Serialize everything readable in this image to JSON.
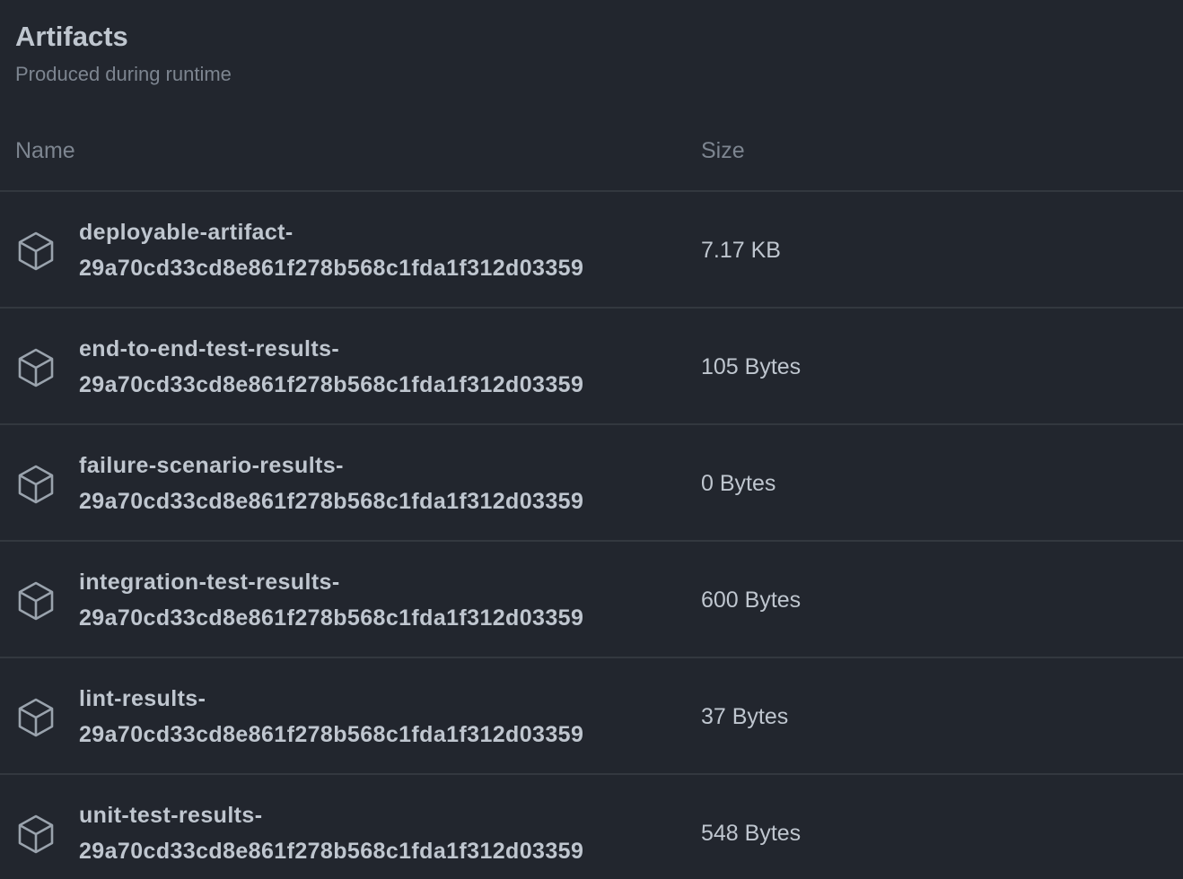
{
  "header": {
    "title": "Artifacts",
    "subtitle": "Produced during runtime"
  },
  "table": {
    "columns": {
      "name": "Name",
      "size": "Size"
    },
    "rows": [
      {
        "name_line1": "deployable-artifact-",
        "name_line2": "29a70cd33cd8e861f278b568c1fda1f312d03359",
        "size": "7.17 KB",
        "icon": "package-icon"
      },
      {
        "name_line1": "end-to-end-test-results-",
        "name_line2": "29a70cd33cd8e861f278b568c1fda1f312d03359",
        "size": "105 Bytes",
        "icon": "package-icon"
      },
      {
        "name_line1": "failure-scenario-results-",
        "name_line2": "29a70cd33cd8e861f278b568c1fda1f312d03359",
        "size": "0 Bytes",
        "icon": "package-icon"
      },
      {
        "name_line1": "integration-test-results-",
        "name_line2": "29a70cd33cd8e861f278b568c1fda1f312d03359",
        "size": "600 Bytes",
        "icon": "package-icon"
      },
      {
        "name_line1": "lint-results-",
        "name_line2": "29a70cd33cd8e861f278b568c1fda1f312d03359",
        "size": "37 Bytes",
        "icon": "package-icon"
      },
      {
        "name_line1": "unit-test-results-",
        "name_line2": "29a70cd33cd8e861f278b568c1fda1f312d03359",
        "size": "548 Bytes",
        "icon": "package-icon"
      }
    ]
  },
  "colors": {
    "background": "#22262e",
    "text": "#bfc6cf",
    "muted": "#7d8590",
    "divider": "#33383f"
  }
}
